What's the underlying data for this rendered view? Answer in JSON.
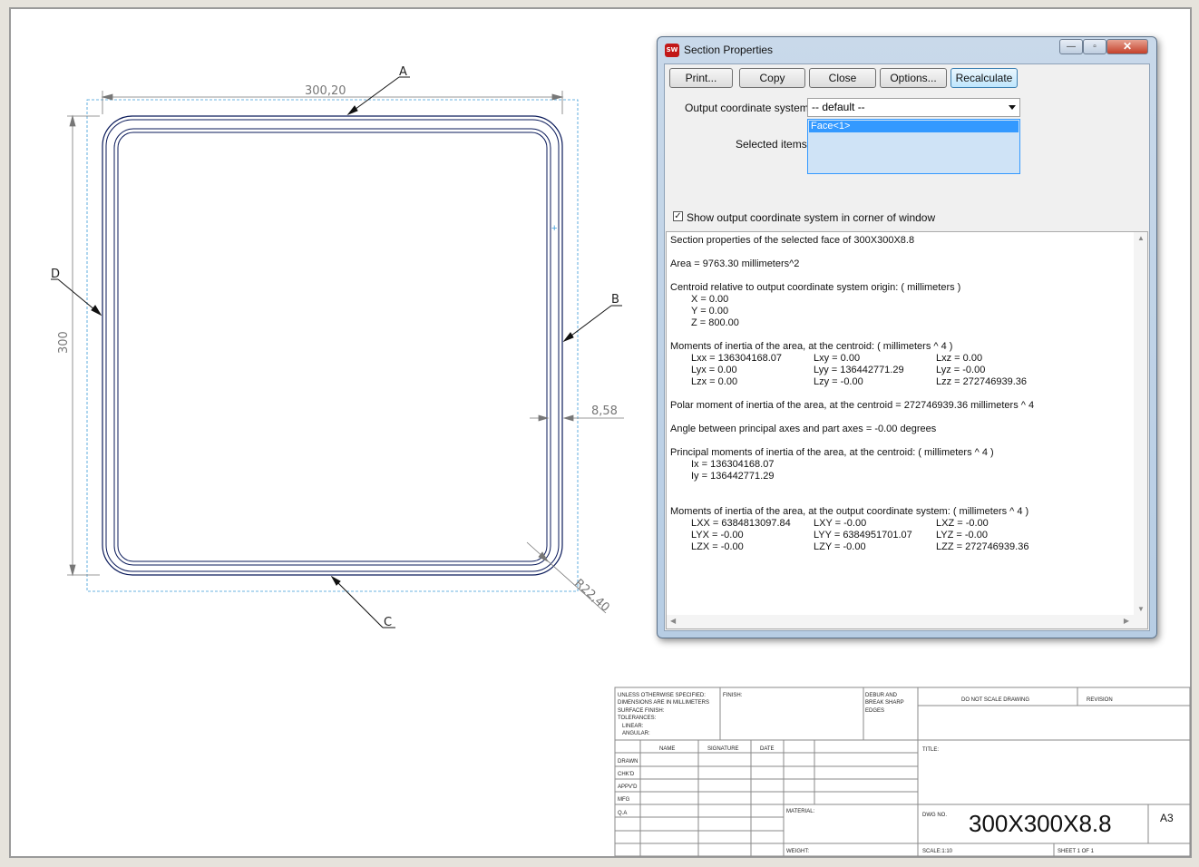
{
  "drawing": {
    "dim_width": "300,20",
    "dim_height": "300",
    "dim_thickness": "8,58",
    "dim_radius": "R22,40",
    "label_a": "A",
    "label_b": "B",
    "label_c": "C",
    "label_d": "D"
  },
  "title_block": {
    "unless": "UNLESS OTHERWISE SPECIFIED:",
    "dims": "DIMENSIONS ARE IN MILLIMETERS",
    "surface": "SURFACE FINISH:",
    "tolerances": "TOLERANCES:",
    "linear": "LINEAR:",
    "angular": "ANGULAR:",
    "finish": "FINISH:",
    "deburr": "DEBUR AND",
    "break": "BREAK SHARP",
    "edges": "EDGES",
    "dnsd": "DO NOT SCALE DRAWING",
    "revision": "REVISION",
    "title": "TITLE:",
    "name": "NAME",
    "signature": "SIGNATURE",
    "date": "DATE",
    "drawn": "DRAWN",
    "chkd": "CHK'D",
    "appvd": "APPV'D",
    "mfg": "MFG",
    "qa": "Q.A",
    "material": "MATERIAL:",
    "weight": "WEIGHT:",
    "dwg_no": "DWG NO.",
    "dwg_value": "300X300X8.8",
    "size": "A3",
    "scale": "SCALE:1:10",
    "sheet": "SHEET 1 OF 1"
  },
  "dialog": {
    "title": "Section Properties",
    "app_icon": "SW",
    "buttons": {
      "print": "Print...",
      "copy": "Copy",
      "close": "Close",
      "options": "Options...",
      "recalculate": "Recalculate"
    },
    "window_controls": {
      "minimize": "—",
      "maximize": "▫",
      "close": "✕"
    },
    "coord_label": "Output coordinate system:",
    "coord_value": "-- default --",
    "selected_label": "Selected items:",
    "selected_item": "Face<1>",
    "show_cs_label": "Show output coordinate system in corner of window",
    "show_cs_checked": "✓",
    "results": {
      "heading": "Section properties of the selected face of 300X300X8.8",
      "area": "Area = 9763.30 millimeters^2",
      "centroid_head": "Centroid relative to output coordinate system origin: ( millimeters )",
      "cx": "X = 0.00",
      "cy": "Y = 0.00",
      "cz": "Z = 800.00",
      "moi_head": "Moments of inertia of the area, at the centroid: ( millimeters ^ 4 )",
      "lxx": "Lxx = 136304168.07",
      "lxy": "Lxy = 0.00",
      "lxz": "Lxz = 0.00",
      "lyx": "Lyx = 0.00",
      "lyy": "Lyy = 136442771.29",
      "lyz": "Lyz = -0.00",
      "lzx": "Lzx = 0.00",
      "lzy": "Lzy = -0.00",
      "lzz": "Lzz = 272746939.36",
      "polar": "Polar moment of inertia of the area, at the centroid = 272746939.36 millimeters ^ 4",
      "angle": "Angle between principal axes and part axes = -0.00 degrees",
      "principal_head": "Principal moments of inertia of the area, at the centroid: ( millimeters ^ 4 )",
      "ix": "Ix = 136304168.07",
      "iy": "Iy = 136442771.29",
      "out_head": "Moments of inertia of the area, at the output coordinate system: ( millimeters ^ 4 )",
      "oLXX": "LXX = 6384813097.84",
      "oLXY": "LXY = -0.00",
      "oLXZ": "LXZ = -0.00",
      "oLYX": "LYX = -0.00",
      "oLYY": "LYY = 6384951701.07",
      "oLYZ": "LYZ = -0.00",
      "oLZX": "LZX = -0.00",
      "oLZY": "LZY = -0.00",
      "oLZZ": "LZZ = 272746939.36"
    }
  }
}
